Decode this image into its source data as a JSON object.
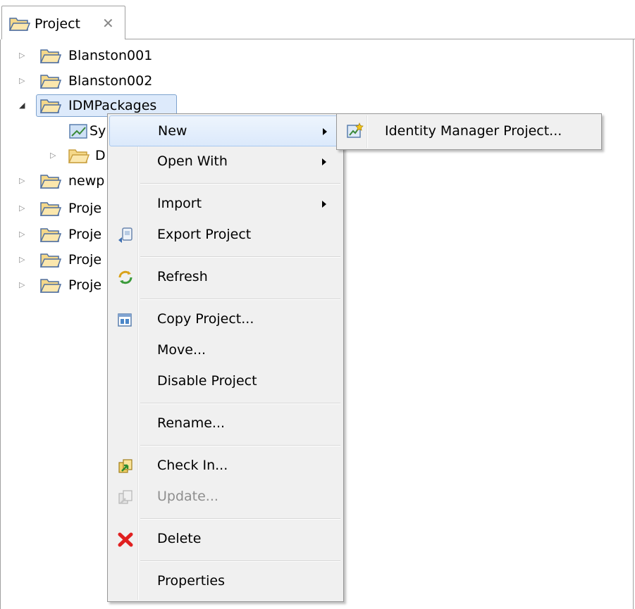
{
  "view_tab": {
    "title": "Project",
    "close_glyph": "✕"
  },
  "tree": {
    "items": [
      {
        "label": "Blanston001",
        "icon": "folder-icon",
        "expanded": false
      },
      {
        "label": "Blanston002",
        "icon": "folder-icon",
        "expanded": false
      },
      {
        "label": "IDMPackages",
        "icon": "folder-icon",
        "expanded": true,
        "selected": true
      },
      {
        "label": "Sy",
        "icon": "system-icon",
        "child": true
      },
      {
        "label": "D",
        "icon": "folder-icon",
        "child": true,
        "expanded": false
      },
      {
        "label": "newp",
        "icon": "folder-icon",
        "expanded": false
      },
      {
        "label": "Proje",
        "icon": "folder-icon",
        "expanded": false
      },
      {
        "label": "Proje",
        "icon": "folder-icon",
        "expanded": false
      },
      {
        "label": "Proje",
        "icon": "folder-icon",
        "expanded": false
      },
      {
        "label": "Proje",
        "icon": "folder-icon",
        "expanded": false
      }
    ]
  },
  "context_menu": {
    "items": [
      {
        "label": "New",
        "submenu": true,
        "highlighted": true
      },
      {
        "label": "Open With",
        "submenu": true
      },
      {
        "label": "Import",
        "submenu": true
      },
      {
        "label": "Export Project",
        "icon": "export-icon"
      },
      {
        "label": "Refresh",
        "icon": "refresh-icon"
      },
      {
        "label": "Copy Project...",
        "icon": "copy-project-icon"
      },
      {
        "label": "Move..."
      },
      {
        "label": "Disable Project"
      },
      {
        "label": "Rename..."
      },
      {
        "label": "Check In...",
        "icon": "check-in-icon"
      },
      {
        "label": "Update...",
        "icon": "update-icon",
        "disabled": true
      },
      {
        "label": "Delete",
        "icon": "delete-icon"
      },
      {
        "label": "Properties"
      }
    ]
  },
  "submenu": {
    "items": [
      {
        "label": "Identity Manager Project...",
        "icon": "identity-manager-project-icon"
      }
    ]
  },
  "colors": {
    "selection": "#ddeafb",
    "menu_background": "#f0f0f0",
    "delete_icon": "#e02020",
    "folder_icon": "#e7b84b"
  }
}
